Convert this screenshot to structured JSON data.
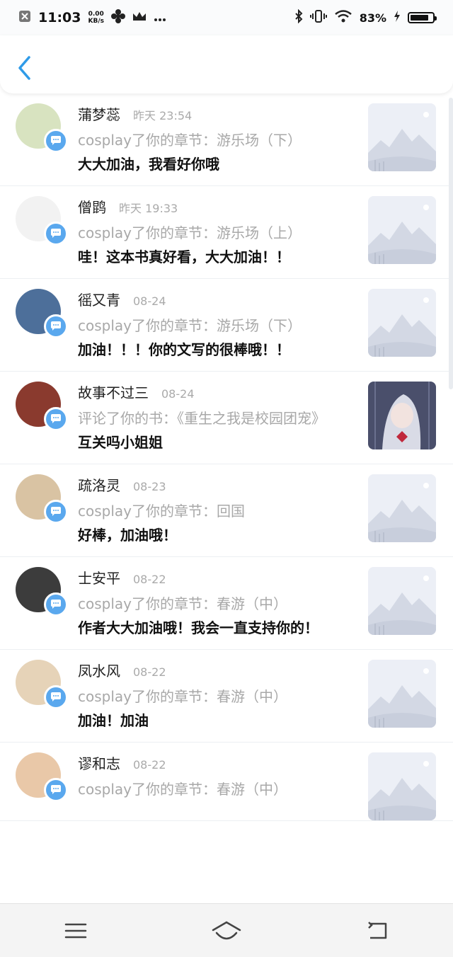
{
  "status_bar": {
    "time": "11:03",
    "speed_value": "0.00",
    "speed_unit": "KB/s",
    "battery": "83%"
  },
  "header": {
    "back_icon": "chevron-left-icon"
  },
  "notifications": [
    {
      "name": "蒲梦蕊",
      "time": "昨天 23:54",
      "action": "cosplay了你的章节：游乐场（下）",
      "comment": "大大加油，我看好你哦",
      "avatar_color": "#d8e3c0",
      "thumb": "placeholder"
    },
    {
      "name": "僧鹍",
      "time": "昨天 19:33",
      "action": "cosplay了你的章节：游乐场（上）",
      "comment": "哇！这本书真好看，大大加油！！",
      "avatar_color": "#f2f2f2",
      "thumb": "placeholder"
    },
    {
      "name": "徭又青",
      "time": "08-24",
      "action": "cosplay了你的章节：游乐场（下）",
      "comment": "加油！！！你的文写的很棒哦！！",
      "avatar_color": "#4d6f9a",
      "thumb": "placeholder"
    },
    {
      "name": "故事不过三",
      "time": "08-24",
      "action": "评论了你的书：《重生之我是校园团宠》",
      "comment": "互关吗小姐姐",
      "avatar_color": "#8a3a2e",
      "thumb": "cover"
    },
    {
      "name": "疏洛灵",
      "time": "08-23",
      "action": "cosplay了你的章节：回国",
      "comment": "好棒，加油哦！",
      "avatar_color": "#d9c3a3",
      "thumb": "placeholder"
    },
    {
      "name": "士安平",
      "time": "08-22",
      "action": "cosplay了你的章节：春游（中）",
      "comment": "作者大大加油哦！我会一直支持你的！",
      "avatar_color": "#3c3c3c",
      "thumb": "placeholder"
    },
    {
      "name": "凤水风",
      "time": "08-22",
      "action": "cosplay了你的章节：春游（中）",
      "comment": "加油！加油",
      "avatar_color": "#e6d3b8",
      "thumb": "placeholder"
    },
    {
      "name": "谬和志",
      "time": "08-22",
      "action": "cosplay了你的章节：春游（中）",
      "comment": "",
      "avatar_color": "#e9c8a8",
      "thumb": "placeholder"
    }
  ],
  "nav": {
    "menu_icon": "menu-icon",
    "home_icon": "home-icon",
    "back_icon": "back-icon"
  }
}
